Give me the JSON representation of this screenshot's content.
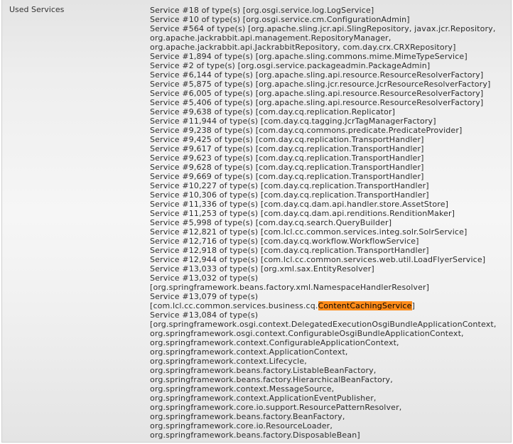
{
  "row": {
    "label": "Used Services"
  },
  "lines": [
    "Service #18 of type(s) [org.osgi.service.log.LogService]",
    "Service #10 of type(s) [org.osgi.service.cm.ConfigurationAdmin]",
    "Service #564 of type(s) [org.apache.sling.jcr.api.SlingRepository, javax.jcr.Repository,",
    "org.apache.jackrabbit.api.management.RepositoryManager,",
    "org.apache.jackrabbit.api.JackrabbitRepository, com.day.crx.CRXRepository]",
    "Service #1,894 of type(s) [org.apache.sling.commons.mime.MimeTypeService]",
    "Service #2 of type(s) [org.osgi.service.packageadmin.PackageAdmin]",
    "Service #6,144 of type(s) [org.apache.sling.api.resource.ResourceResolverFactory]",
    "Service #5,875 of type(s) [org.apache.sling.jcr.resource.JcrResourceResolverFactory]",
    "Service #6,005 of type(s) [org.apache.sling.api.resource.ResourceResolverFactory]",
    "Service #5,406 of type(s) [org.apache.sling.api.resource.ResourceResolverFactory]",
    "Service #9,638 of type(s) [com.day.cq.replication.Replicator]",
    "Service #11,944 of type(s) [com.day.cq.tagging.JcrTagManagerFactory]",
    "Service #9,238 of type(s) [com.day.cq.commons.predicate.PredicateProvider]",
    "Service #9,425 of type(s) [com.day.cq.replication.TransportHandler]",
    "Service #9,617 of type(s) [com.day.cq.replication.TransportHandler]",
    "Service #9,623 of type(s) [com.day.cq.replication.TransportHandler]",
    "Service #9,628 of type(s) [com.day.cq.replication.TransportHandler]",
    "Service #9,669 of type(s) [com.day.cq.replication.TransportHandler]",
    "Service #10,227 of type(s) [com.day.cq.replication.TransportHandler]",
    "Service #10,306 of type(s) [com.day.cq.replication.TransportHandler]",
    "Service #11,336 of type(s) [com.day.cq.dam.api.handler.store.AssetStore]",
    "Service #11,253 of type(s) [com.day.cq.dam.api.renditions.RenditionMaker]",
    "Service #5,998 of type(s) [com.day.cq.search.QueryBuilder]",
    "Service #12,821 of type(s) [com.lcl.cc.common.services.integ.solr.SolrService]",
    "Service #12,716 of type(s) [com.day.cq.workflow.WorkflowService]",
    "Service #12,918 of type(s) [com.day.cq.replication.TransportHandler]",
    "Service #12,944 of type(s) [com.lcl.cc.common.services.web.util.LoadFlyerService]",
    "Service #13,033 of type(s) [org.xml.sax.EntityResolver]",
    "Service #13,032 of type(s)",
    "[org.springframework.beans.factory.xml.NamespaceHandlerResolver]",
    "Service #13,079 of type(s)",
    "__HIGHLIGHT__",
    "Service #13,084 of type(s)",
    "[org.springframework.osgi.context.DelegatedExecutionOsgiBundleApplicationContext,",
    "org.springframework.osgi.context.ConfigurableOsgiBundleApplicationContext,",
    "org.springframework.context.ConfigurableApplicationContext,",
    "org.springframework.context.ApplicationContext,",
    "org.springframework.context.Lifecycle,",
    "org.springframework.beans.factory.ListableBeanFactory,",
    "org.springframework.beans.factory.HierarchicalBeanFactory,",
    "org.springframework.context.MessageSource,",
    "org.springframework.context.ApplicationEventPublisher,",
    "org.springframework.core.io.support.ResourcePatternResolver,",
    "org.springframework.beans.factory.BeanFactory,",
    "org.springframework.core.io.ResourceLoader,",
    "org.springframework.beans.factory.DisposableBean]"
  ],
  "highlighted_line": {
    "prefix": "[com.lcl.cc.common.services.business.cq.",
    "match": "ContentCachingService",
    "suffix": "]"
  },
  "colors": {
    "highlight": "#ff8c1a",
    "text": "#2b2b2b"
  }
}
